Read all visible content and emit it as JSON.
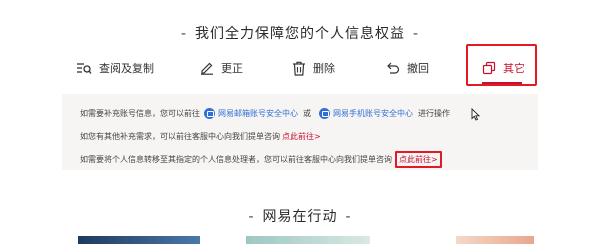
{
  "top_heading": {
    "dash_left": "-",
    "title": "我们全力保障您的个人信息权益",
    "dash_right": "-"
  },
  "tabs": [
    {
      "label": "查阅及复制",
      "icon": "search-list-icon"
    },
    {
      "label": "更正",
      "icon": "pencil-icon"
    },
    {
      "label": "删除",
      "icon": "trash-icon"
    },
    {
      "label": "撤回",
      "icon": "undo-icon"
    },
    {
      "label": "其它",
      "icon": "copy-icon",
      "active": true
    }
  ],
  "panel": {
    "line1": {
      "prefix": "如需要补充账号信息，您可以前往",
      "link1": "网易邮箱账号安全中心",
      "middle": "或",
      "link2": "网易手机账号安全中心",
      "suffix": "进行操作"
    },
    "line2": {
      "text": "如您有其他补充需求，可以前往客服中心向我们提单咨询",
      "link": "点此前往>"
    },
    "line3": {
      "text": "如需要将个人信息转移至其指定的个人信息处理者，您可以前往客服中心向我们提单咨询",
      "link": "点此前往>"
    }
  },
  "bottom_heading": {
    "dash_left": "-",
    "title": "网易在行动",
    "dash_right": "-"
  },
  "colors": {
    "accent": "#c8102e",
    "highlight_box": "#e01b24",
    "link_blue": "#2f6fd6",
    "panel_bg": "#f7f5f3"
  }
}
